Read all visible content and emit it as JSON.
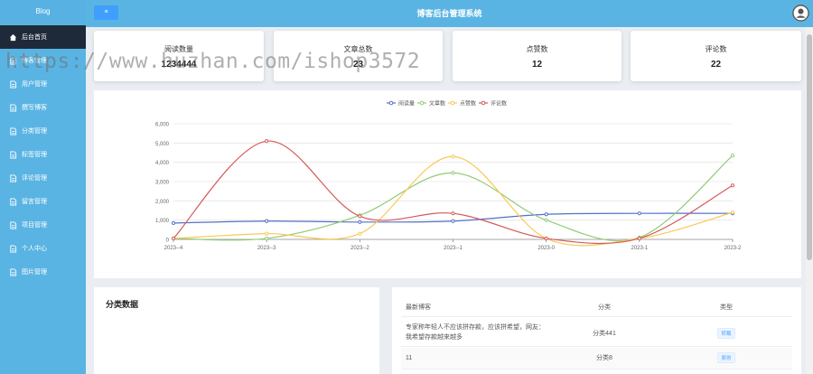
{
  "sidebar": {
    "brand": "Blog",
    "items": [
      {
        "label": "后台首页",
        "active": true
      },
      {
        "label": "博客管理"
      },
      {
        "label": "用户管理"
      },
      {
        "label": "撰写博客"
      },
      {
        "label": "分类管理"
      },
      {
        "label": "标签管理"
      },
      {
        "label": "评论管理"
      },
      {
        "label": "留言管理"
      },
      {
        "label": "项目管理"
      },
      {
        "label": "个人中心"
      },
      {
        "label": "图片管理"
      }
    ]
  },
  "header": {
    "toggle_label": "≡",
    "title": "博客后台管理系统"
  },
  "stats": [
    {
      "label": "阅读数量",
      "value": "1234444"
    },
    {
      "label": "文章总数",
      "value": "23"
    },
    {
      "label": "点赞数",
      "value": "12"
    },
    {
      "label": "评论数",
      "value": "22"
    }
  ],
  "chart_data": {
    "type": "line",
    "categories": [
      "2023--4",
      "2023--3",
      "2023--2",
      "2023--1",
      "2023-0",
      "2023-1",
      "2023-2"
    ],
    "ylim": [
      0,
      6000
    ],
    "yticks": [
      "0",
      "1,000",
      "2,000",
      "3,000",
      "4,000",
      "5,000",
      "6,000"
    ],
    "legend_position": "top-center",
    "smooth": true,
    "series": [
      {
        "name": "阅读量",
        "color": "#5470c6",
        "values": [
          850,
          950,
          900,
          950,
          1300,
          1350,
          1350
        ]
      },
      {
        "name": "文章数",
        "color": "#91cc75",
        "values": [
          50,
          50,
          1250,
          3450,
          1000,
          100,
          4350
        ]
      },
      {
        "name": "点赞数",
        "color": "#fac858",
        "values": [
          50,
          300,
          300,
          4300,
          50,
          50,
          1400
        ]
      },
      {
        "name": "评论数",
        "color": "#d45a5a",
        "values": [
          50,
          5100,
          1200,
          1350,
          50,
          50,
          2800
        ]
      }
    ]
  },
  "category_panel": {
    "title": "分类数据"
  },
  "recent_table": {
    "headers": [
      "最新博客",
      "分类",
      "类型"
    ],
    "rows": [
      {
        "title": "专家称年轻人不应该拼存款，应该拼希望，网友：我希望存款越来越多",
        "category": "分类441",
        "type": "转载"
      },
      {
        "title": "11",
        "category": "分类8",
        "type": "原创"
      }
    ]
  },
  "watermark": "https://www.huzhan.com/ishop3572"
}
